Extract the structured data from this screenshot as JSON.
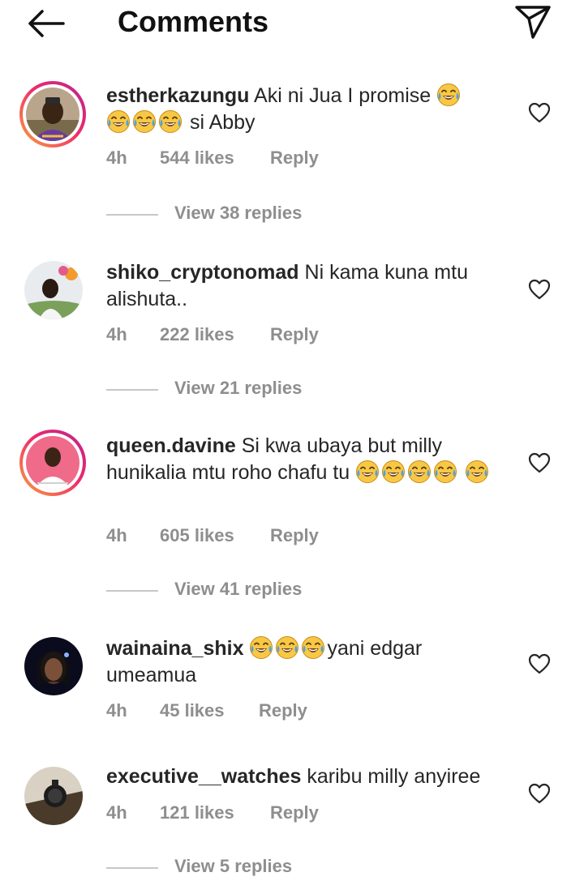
{
  "header": {
    "title": "Comments",
    "back_icon": "arrow-left-icon",
    "share_icon": "paper-plane-icon"
  },
  "comments": [
    {
      "username": "estherkazungu",
      "text_1": "Aki ni Jua I promise",
      "text_2": "si Abby",
      "time": "4h",
      "likes": "544 likes",
      "reply": "Reply",
      "view_replies": "View 38 replies"
    },
    {
      "username": "shiko_cryptonomad",
      "text_1": "Ni kama kuna mtu alishuta..",
      "time": "4h",
      "likes": "222 likes",
      "reply": "Reply",
      "view_replies": "View 21 replies"
    },
    {
      "username": "queen.davine",
      "text_1": "Si kwa ubaya but milly hunikalia mtu roho chafu tu",
      "time": "4h",
      "likes": "605 likes",
      "reply": "Reply",
      "view_replies": "View 41 replies"
    },
    {
      "username": "wainaina_shix",
      "text_1": "yani edgar umeamua",
      "time": "4h",
      "likes": "45 likes",
      "reply": "Reply"
    },
    {
      "username": "executive__watches",
      "text_1": "karibu milly anyiree",
      "time": "4h",
      "likes": "121 likes",
      "reply": "Reply",
      "view_replies": "View 5 replies"
    }
  ],
  "colors": {
    "text": "#262626",
    "secondary": "#8e8e8e",
    "story_ring_start": "#f9a33c",
    "story_ring_end": "#b9258f"
  }
}
